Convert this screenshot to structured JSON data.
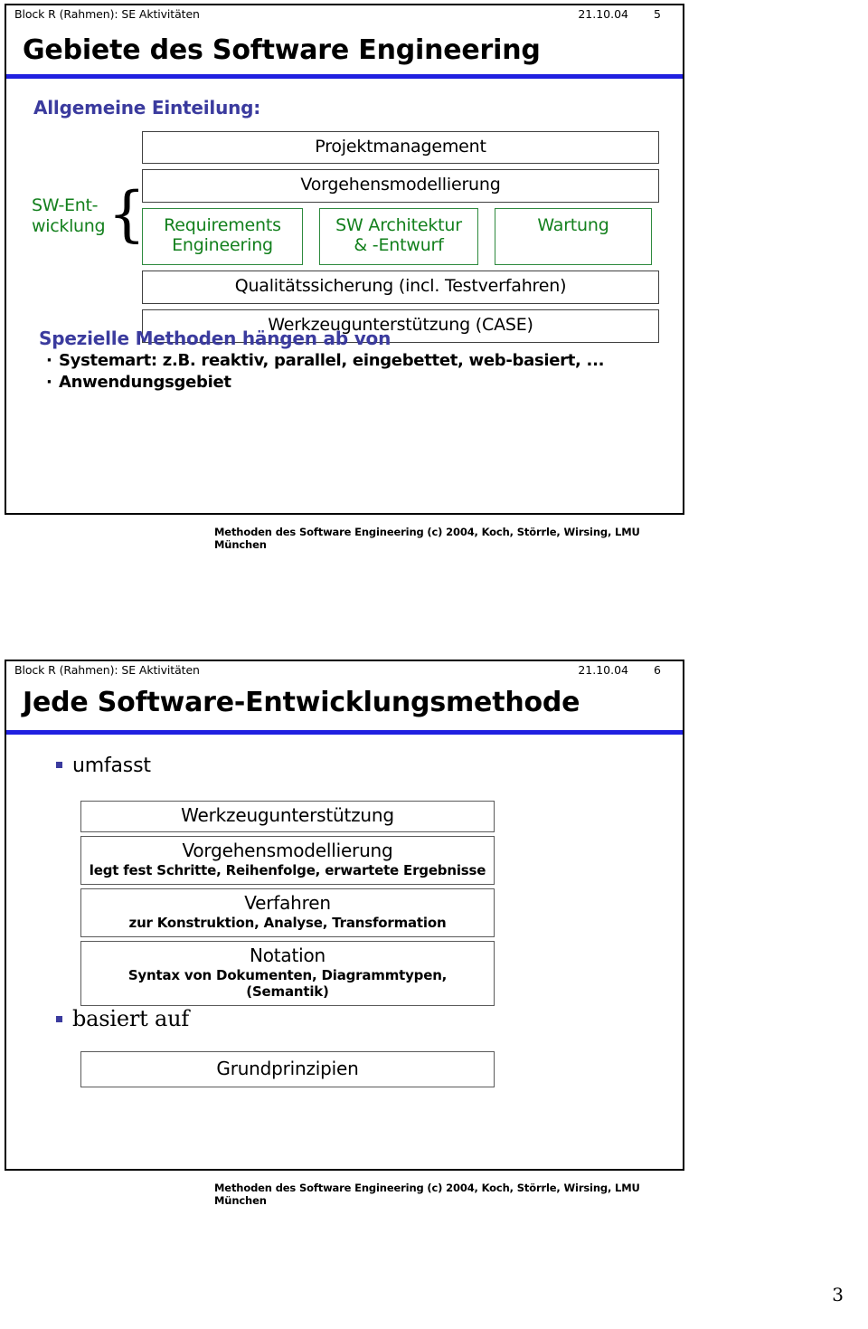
{
  "document": {
    "page_number": "3"
  },
  "slides": [
    {
      "header": {
        "left": "Block R (Rahmen): SE Aktivitäten",
        "date": "21.10.04",
        "page": "5"
      },
      "title": "Gebiete des Software Engineering",
      "section_heading_1": "Allgemeine Einteilung:",
      "diagram": {
        "top_boxes": [
          "Projektmanagement",
          "Vorgehensmodellierung"
        ],
        "brace_label_line1": "SW-Ent-",
        "brace_label_line2": "wicklung",
        "brace_glyph": "{",
        "middle_boxes": [
          {
            "line1": "Requirements",
            "line2": "Engineering"
          },
          {
            "line1": "SW Architektur",
            "line2": "& -Entwurf"
          },
          {
            "line1": "Wartung",
            "line2": ""
          }
        ],
        "bottom_boxes": [
          "Qualitätssicherung (incl. Testverfahren)",
          "Werkzeugunterstützung (CASE)"
        ]
      },
      "section_heading_2": "Spezielle Methoden hängen ab von",
      "bullets": [
        {
          "marker": "·",
          "text": "Systemart: z.B. reaktiv, parallel, eingebettet, web-basiert, ..."
        },
        {
          "marker": "·",
          "text": "Anwendungsgebiet"
        }
      ],
      "footer": "Methoden des Software Engineering (c) 2004, Koch, Störrle, Wirsing, LMU München"
    },
    {
      "header": {
        "left": "Block R (Rahmen): SE Aktivitäten",
        "date": "21.10.04",
        "page": "6"
      },
      "title": "Jede Software-Entwicklungsmethode",
      "item_umfasst": "umfasst",
      "item_basiert_auf": "basiert auf",
      "stack_boxes": [
        {
          "main": "Werkzeugunterstützung",
          "sub": ""
        },
        {
          "main": "Vorgehensmodellierung",
          "sub": "legt fest Schritte, Reihenfolge, erwartete Ergebnisse"
        },
        {
          "main": "Verfahren",
          "sub": "zur Konstruktion, Analyse, Transformation"
        },
        {
          "main": "Notation",
          "sub": "Syntax von Dokumenten, Diagrammtypen, (Semantik)"
        }
      ],
      "basis_box": "Grundprinzipien",
      "footer": "Methoden des Software Engineering (c) 2004, Koch, Störrle, Wirsing, LMU München"
    }
  ],
  "colors": {
    "title_rule": "#2020e0",
    "heading_blue": "#3b3b9e",
    "green": "#13801d",
    "box_border": "#404040"
  }
}
